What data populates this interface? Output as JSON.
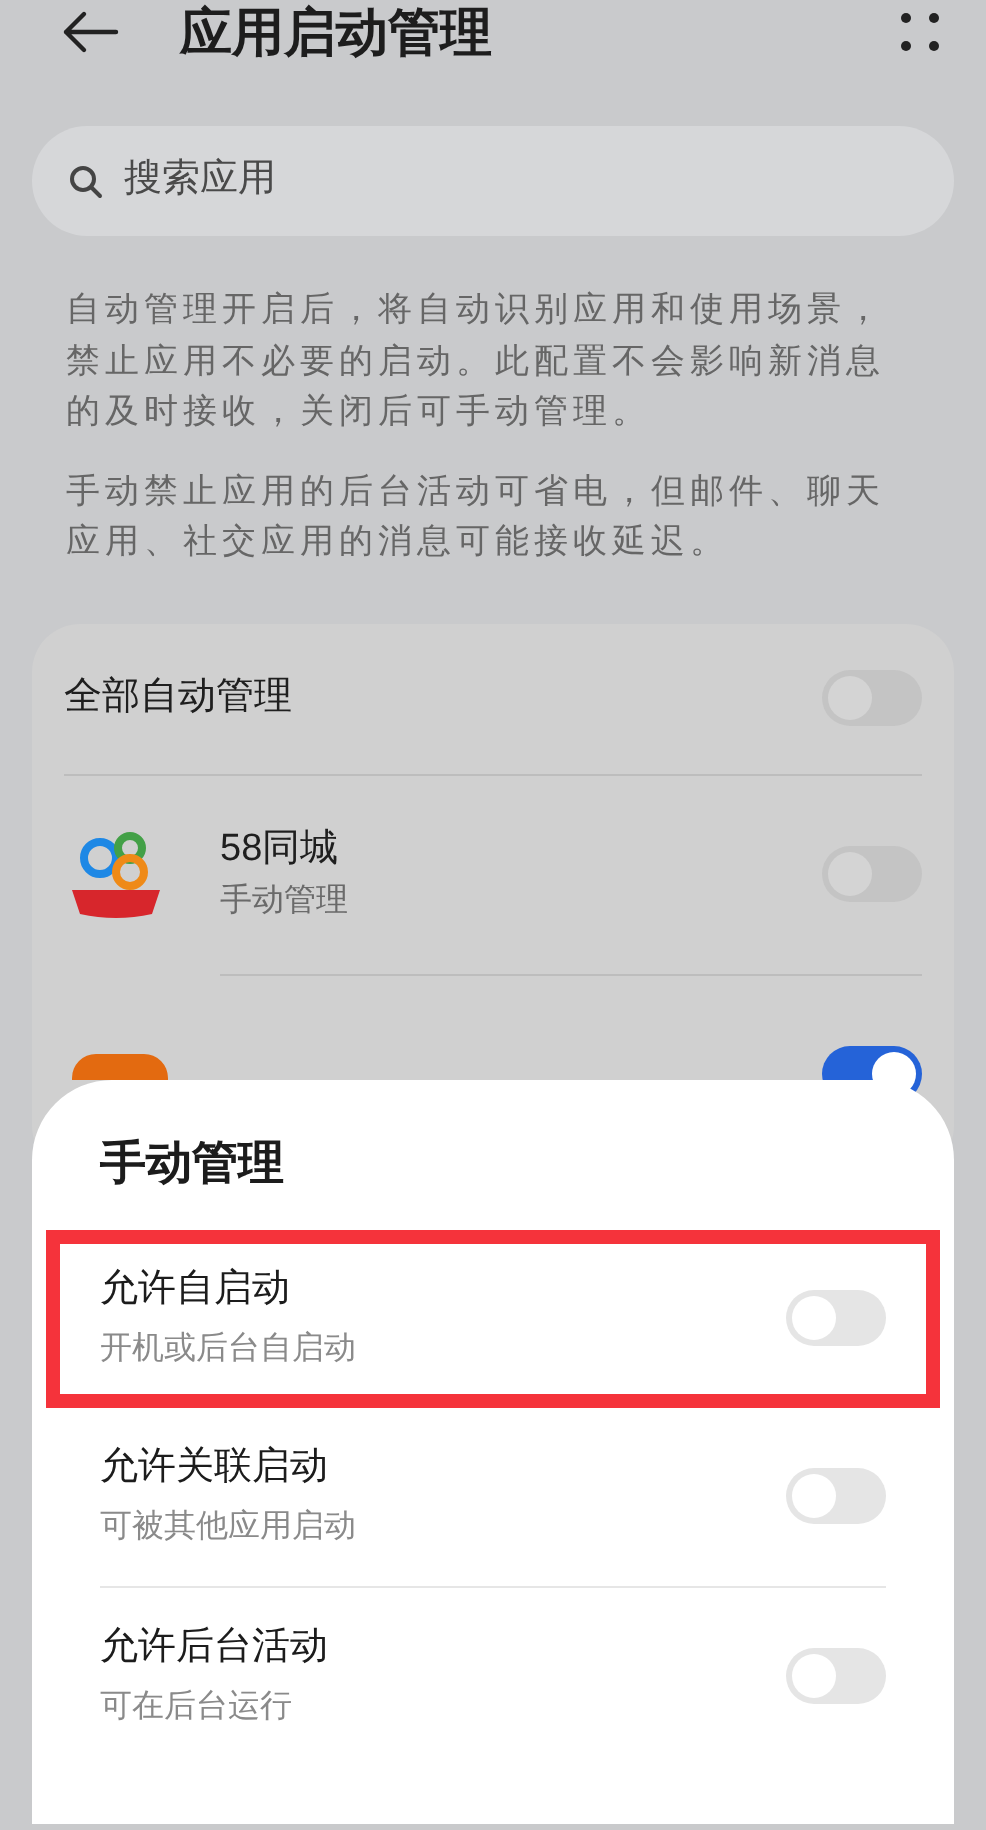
{
  "header": {
    "title": "应用启动管理"
  },
  "search": {
    "placeholder": "搜索应用"
  },
  "description": [
    "自动管理开启后，将自动识别应用和使用场景，禁止应用不必要的启动。此配置不会影响新消息的及时接收，关闭后可手动管理。",
    "手动禁止应用的后台活动可省电，但邮件、聊天应用、社交应用的消息可能接收延迟。"
  ],
  "all_auto": {
    "label": "全部自动管理",
    "on": false
  },
  "apps": [
    {
      "name": "58同城",
      "status": "手动管理",
      "on": false
    },
    {
      "on": true
    }
  ],
  "sheet": {
    "title": "手动管理",
    "options": [
      {
        "label": "允许自启动",
        "sublabel": "开机或后台自启动",
        "on": false,
        "highlighted": true
      },
      {
        "label": "允许关联启动",
        "sublabel": "可被其他应用启动",
        "on": false,
        "highlighted": false
      },
      {
        "label": "允许后台活动",
        "sublabel": "可在后台运行",
        "on": false,
        "highlighted": false
      }
    ]
  }
}
